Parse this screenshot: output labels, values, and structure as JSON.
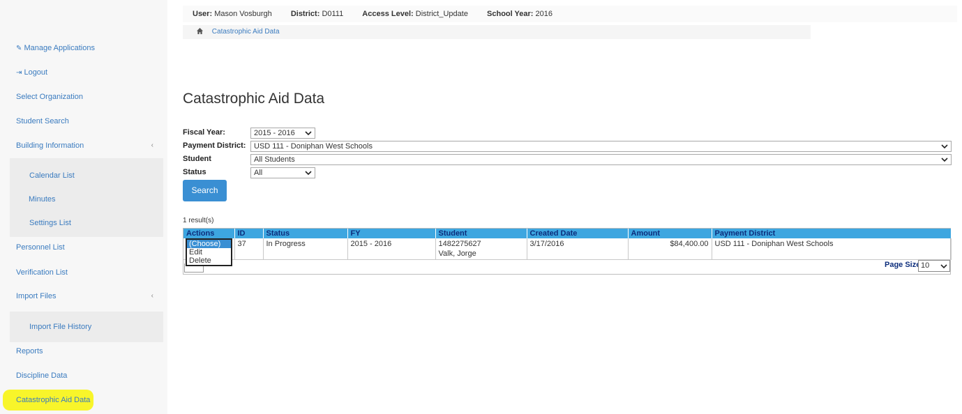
{
  "sidebar": {
    "items": [
      {
        "label": "Manage Applications",
        "icon": "link-icon"
      },
      {
        "label": "Logout",
        "icon": "logout-icon"
      },
      {
        "label": "Select Organization"
      },
      {
        "label": "Student Search"
      },
      {
        "label": "Building Information",
        "chevron": "‹"
      },
      {
        "label": "Personnel List"
      },
      {
        "label": "Verification List"
      },
      {
        "label": "Import Files",
        "chevron": "‹"
      },
      {
        "label": "Reports"
      },
      {
        "label": "Discipline Data"
      },
      {
        "label": "Catastrophic Aid Data"
      }
    ],
    "building_sub": [
      {
        "label": "Calendar List"
      },
      {
        "label": "Minutes"
      },
      {
        "label": "Settings List"
      }
    ],
    "import_sub": [
      {
        "label": "Import File History"
      }
    ],
    "highlight_color": "#f8f52a"
  },
  "userbar": {
    "user_label": "User:",
    "user_value": "Mason Vosburgh",
    "district_label": "District:",
    "district_value": "D0111",
    "access_label": "Access Level:",
    "access_value": "District_Update",
    "year_label": "School Year:",
    "year_value": "2016"
  },
  "breadcrumb": {
    "icon": "home-icon",
    "current": "Catastrophic Aid Data"
  },
  "page": {
    "title": "Catastrophic Aid Data"
  },
  "filters": {
    "fiscal_year_label": "Fiscal Year:",
    "fiscal_year_value": "2015 - 2016",
    "payment_district_label": "Payment District:",
    "payment_district_value": "USD 111 - Doniphan West Schools",
    "student_label": "Student",
    "student_value": "All Students",
    "status_label": "Status",
    "status_value": "All",
    "search_label": "Search"
  },
  "results": {
    "count_text": "1 result(s)",
    "columns": [
      "Actions",
      "ID",
      "Status",
      "FY",
      "Student",
      "Created Date",
      "Amount",
      "Payment District"
    ],
    "row": {
      "id": "37",
      "status": "In Progress",
      "fy": "2015 - 2016",
      "student_id": "1482275627",
      "student_name": "Valk, Jorge",
      "created_date": "3/17/2016",
      "amount": "$84,400.00",
      "payment_district": "USD 111 - Doniphan West Schools"
    },
    "actions_menu": [
      "(Choose)",
      "Edit",
      "Delete"
    ],
    "page_size_label": "Page Size:",
    "page_size_value": "10"
  },
  "colors": {
    "header_blue": "#3da6e0",
    "link_blue": "#3a7bbf",
    "button_blue": "#3a8fd3"
  }
}
